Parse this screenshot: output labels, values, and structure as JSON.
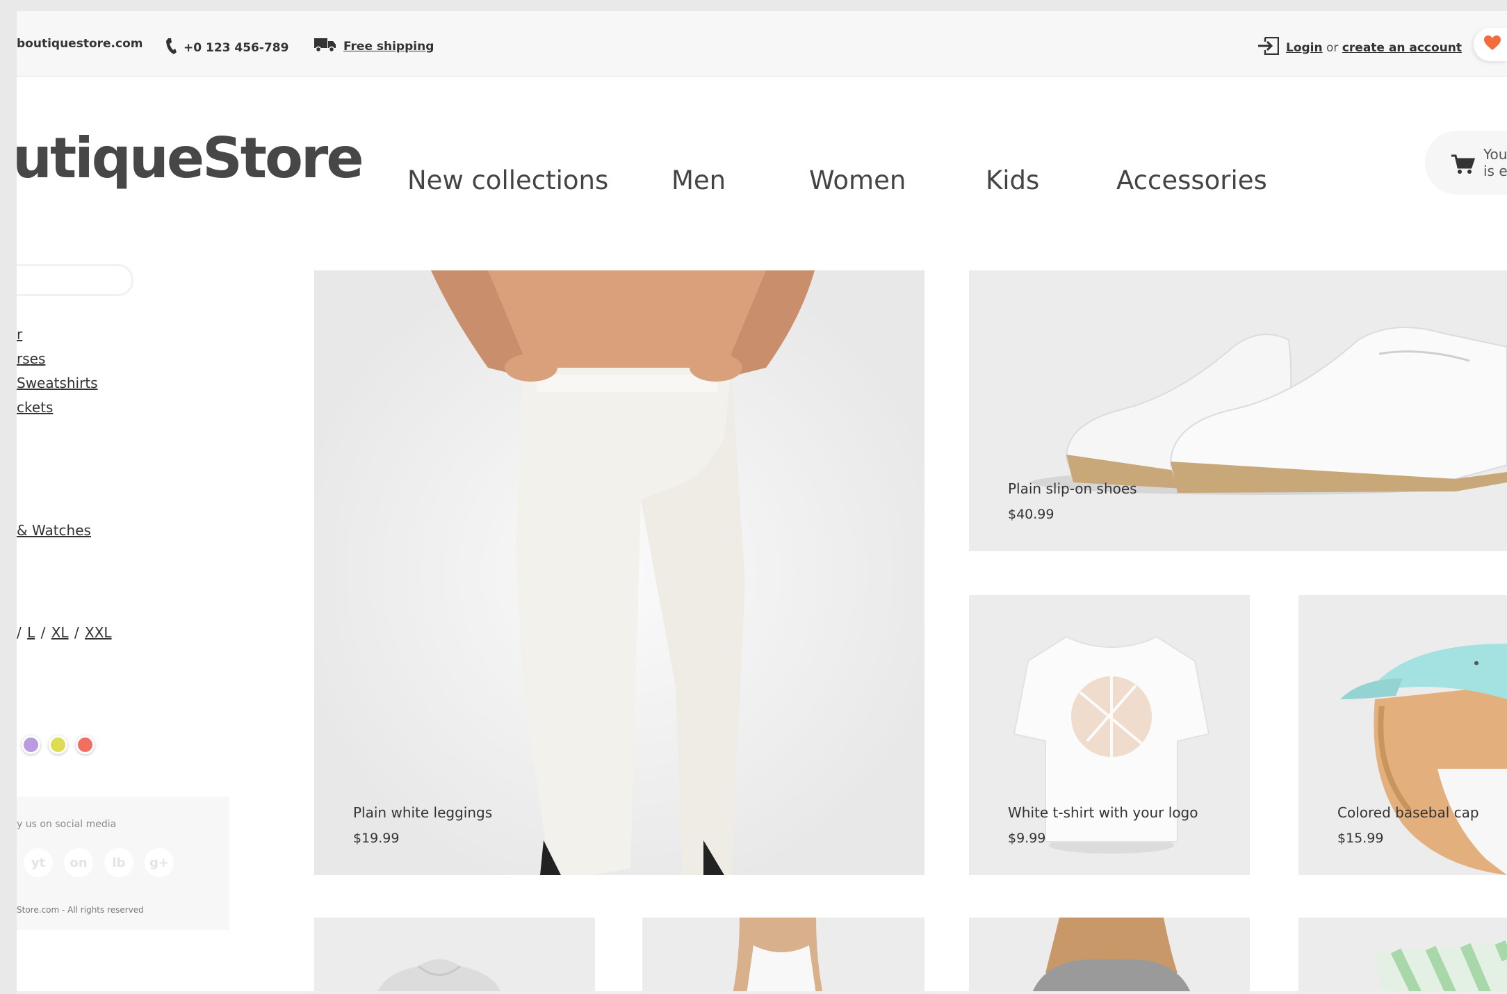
{
  "topbar": {
    "domain": "boutiquestore.com",
    "phone": "+0 123 456-789",
    "shipping_label": "Free shipping",
    "login_label": "Login",
    "or_text": " or ",
    "create_account_label": "create an account"
  },
  "header": {
    "logo_text": "utiqueStore",
    "nav": [
      {
        "label": "New collections"
      },
      {
        "label": "Men"
      },
      {
        "label": "Women"
      },
      {
        "label": "Kids"
      },
      {
        "label": "Accessories"
      }
    ],
    "cart_line1": "You",
    "cart_line2": "is er"
  },
  "sidebar": {
    "search_placeholder": "",
    "categories": [
      {
        "label": "r"
      },
      {
        "label": "rses"
      },
      {
        "label": " Sweatshirts"
      },
      {
        "label": "ckets"
      },
      {
        "label": "& Watches"
      }
    ],
    "sizes": [
      {
        "label": "L"
      },
      {
        "label": "XL"
      },
      {
        "label": "XXL"
      }
    ],
    "sizes_prefix": "/ ",
    "size_separator": " / ",
    "colors": [
      "#b89be0",
      "#dedc52",
      "#ef6f61"
    ],
    "social_title": "y us on social media",
    "social": [
      {
        "label": "yt"
      },
      {
        "label": "on"
      },
      {
        "label": "lb"
      },
      {
        "label": "g+"
      }
    ],
    "copyright": "Store.com - All rights reserved"
  },
  "products": [
    {
      "name": "Plain white leggings",
      "price": "$19.99"
    },
    {
      "name": "Plain slip-on shoes",
      "price": "$40.99"
    },
    {
      "name": "White t-shirt with your logo",
      "price": "$9.99"
    },
    {
      "name": "Colored basebal cap",
      "price": "$15.99"
    }
  ],
  "colors": {
    "accent": "#f26d3d",
    "page_bg": "#ffffff",
    "card_bg": "#ececec",
    "topbar_bg": "#f7f7f7"
  }
}
